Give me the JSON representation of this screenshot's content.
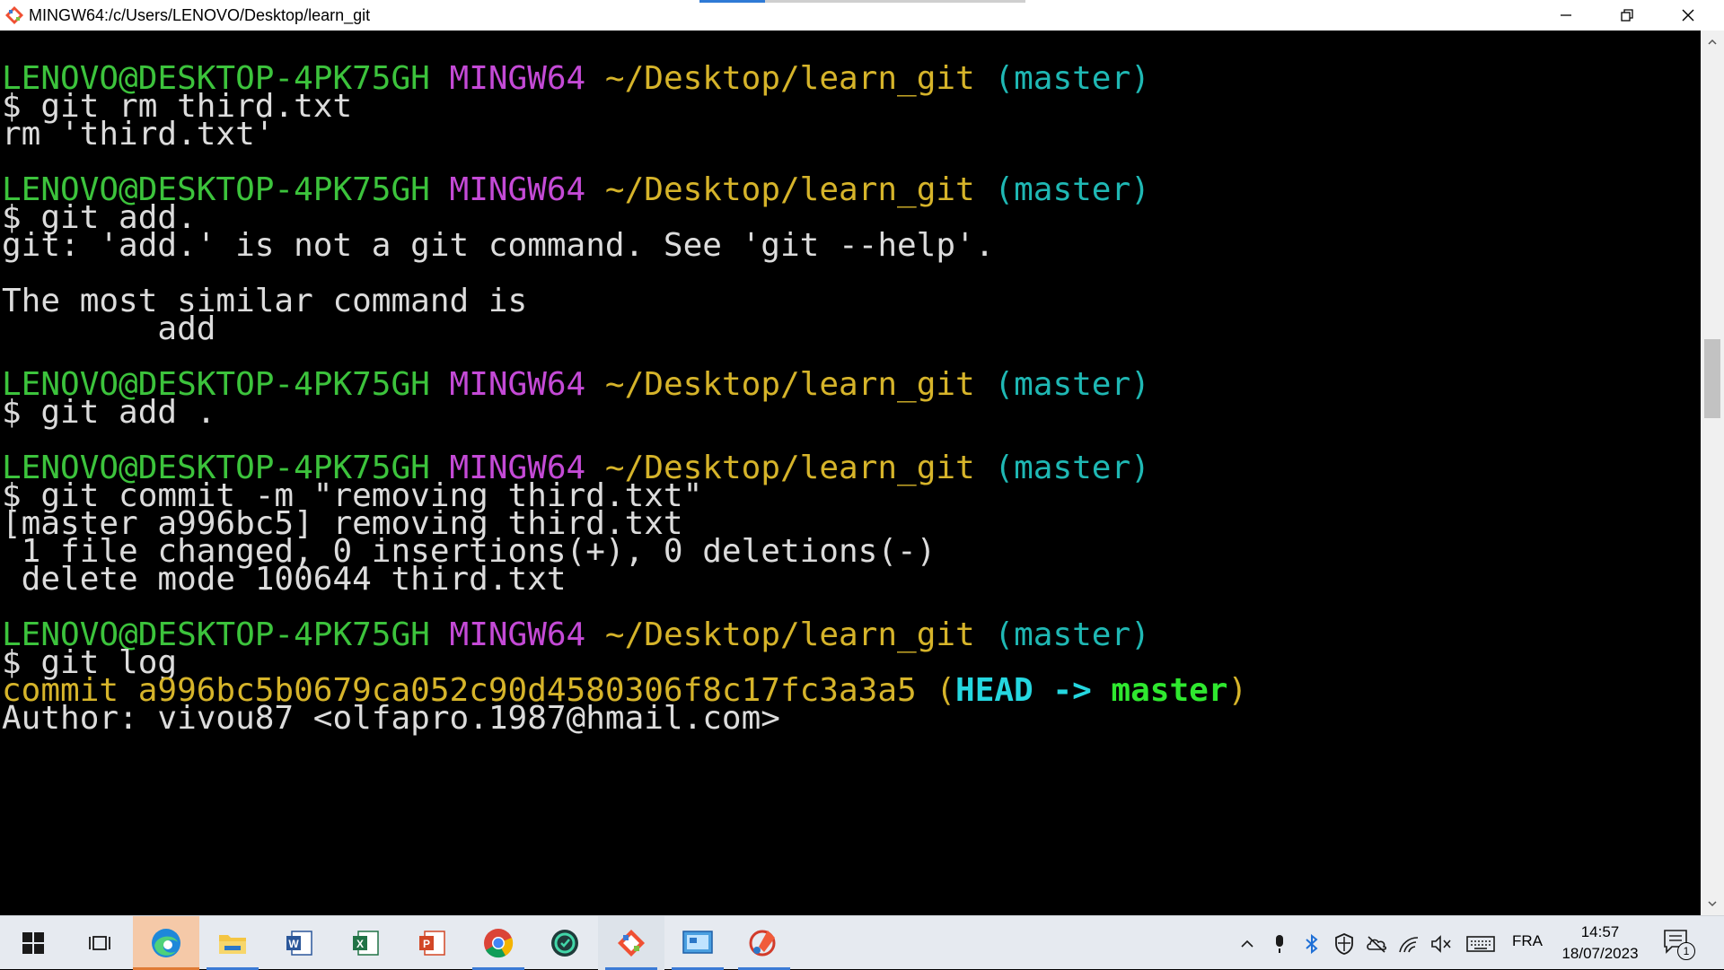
{
  "window": {
    "title": "MINGW64:/c/Users/LENOVO/Desktop/learn_git",
    "minimize_icon": "minimize-icon",
    "restore_icon": "restore-icon",
    "close_icon": "close-icon"
  },
  "prompt": {
    "user": "LENOVO@DESKTOP-4PK75GH",
    "system": "MINGW64",
    "path": "~/Desktop/learn_git",
    "branch": "(master)"
  },
  "terminal": {
    "blocks": [
      {
        "command": "$ git rm third.txt",
        "output": [
          "rm 'third.txt'"
        ]
      },
      {
        "command": "$ git add.",
        "output": [
          "git: 'add.' is not a git command. See 'git --help'.",
          "",
          "The most similar command is",
          "        add"
        ]
      },
      {
        "command": "$ git add .",
        "output": []
      },
      {
        "command": "$ git commit -m \"removing third.txt\"",
        "output": [
          "[master a996bc5] removing third.txt",
          " 1 file changed, 0 insertions(+), 0 deletions(-)",
          " delete mode 100644 third.txt"
        ]
      },
      {
        "command": "$ git log",
        "output": []
      }
    ],
    "log": {
      "commit_prefix": "commit a996bc5b0679ca052c90d4580306f8c17fc3a3a5 ",
      "paren_open": "(",
      "head": "HEAD -> ",
      "master": "master",
      "paren_close": ")",
      "author": "Author: vivou87 <olfapro.1987@hmail.com>"
    }
  },
  "taskbar": {
    "items": [
      {
        "name": "start-icon"
      },
      {
        "name": "task-view-icon"
      },
      {
        "name": "edge-icon"
      },
      {
        "name": "file-explorer-icon"
      },
      {
        "name": "word-icon"
      },
      {
        "name": "excel-icon"
      },
      {
        "name": "powerpoint-icon"
      },
      {
        "name": "chrome-icon"
      },
      {
        "name": "vpn-icon"
      },
      {
        "name": "git-bash-icon"
      },
      {
        "name": "control-panel-icon"
      },
      {
        "name": "paint-icon"
      }
    ],
    "tray": {
      "language": "FRA",
      "time": "14:57",
      "date": "18/07/2023",
      "notifications": "1"
    }
  },
  "colors": {
    "user": "#3cc33c",
    "system": "#c44ad6",
    "path": "#d6b42a",
    "branch": "#1fb8b4",
    "head": "#25d7e0",
    "master": "#2fe82f",
    "text": "#dcdcdc"
  }
}
